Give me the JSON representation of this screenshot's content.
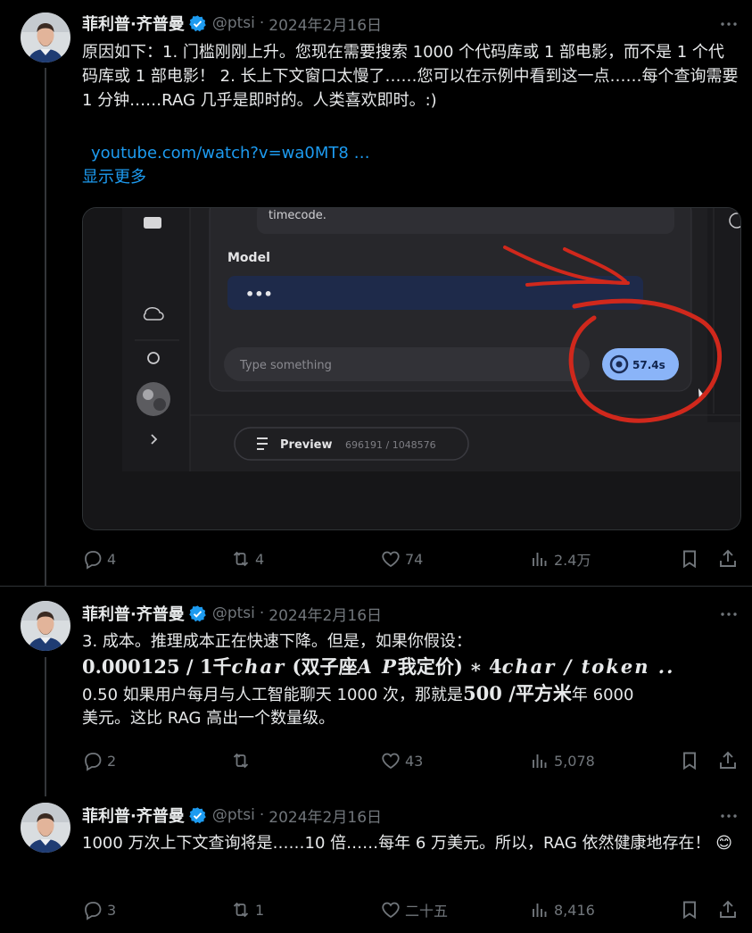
{
  "tweets": [
    {
      "author": "菲利普·齐普曼",
      "handle": "@ptsi",
      "dot": "·",
      "date": "2024年2月16日",
      "text": "原因如下：1. 门槛刚刚上升。您现在需要搜索 1000 个代码库或 1 部电影，而不是 1 个代码库或 1 部电影！ 2. 长上下文窗口太慢了……您可以在示例中看到这一点……每个查询需要 1 分钟……RAG 几乎是即时的。人类喜欢即时。:)",
      "link": "youtube.com/watch?v=wa0MT8 …",
      "show_more": "显示更多",
      "media": {
        "model_label": "Model",
        "model_dots": "•••",
        "timecode_text": "timecode.",
        "input_placeholder": "Type something",
        "timer": "57.4s",
        "preview_label": "Preview",
        "token_count": "696191 / 1048576"
      },
      "stats": {
        "replies": "4",
        "retweets": "4",
        "likes": "74",
        "views": "2.4万"
      }
    },
    {
      "author": "菲利普·齐普曼",
      "handle": "@ptsi",
      "dot": "·",
      "date": "2024年2月16日",
      "line1": "3. 成本。推理成本正在快速下降。但是，如果你假设：",
      "math_a": "0.000125 / 1千",
      "math_b": "char",
      "math_c": " (双子座",
      "math_d": "A P",
      "math_e": "我定价) ∗ 4",
      "math_f": "char / token ..",
      "line3a": "0.50 如果用户每月与人工智能聊天 1000 次，那就是",
      "line3b": "500 /平方米",
      "line3c": "年 6000",
      "line4": "美元。这比 RAG 高出一个数量级。",
      "stats": {
        "replies": "2",
        "retweets": "",
        "likes": "43",
        "views": "5,078"
      }
    },
    {
      "author": "菲利普·齐普曼",
      "handle": "@ptsi",
      "dot": "·",
      "date": "2024年2月16日",
      "text": "1000 万次上下文查询将是……10 倍……每年 6 万美元。所以，RAG 依然健康地存在！ ",
      "emoji": "😊",
      "stats": {
        "replies": "3",
        "retweets": "1",
        "likes": "二十五",
        "views": "8,416"
      }
    }
  ],
  "colors": {
    "background": "#000000",
    "text": "#e7e9ea",
    "secondary": "#71767b",
    "link": "#1d9bf0",
    "verified": "#1d9bf0",
    "divider": "#2f3336",
    "annotation_red": "#d0281c",
    "timer_pill": "#8ab4f8",
    "model_field": "#1e2a4a"
  },
  "icons": [
    "verified-badge-icon",
    "more-icon",
    "reply-icon",
    "retweet-icon",
    "like-icon",
    "views-icon",
    "bookmark-icon",
    "share-icon"
  ]
}
